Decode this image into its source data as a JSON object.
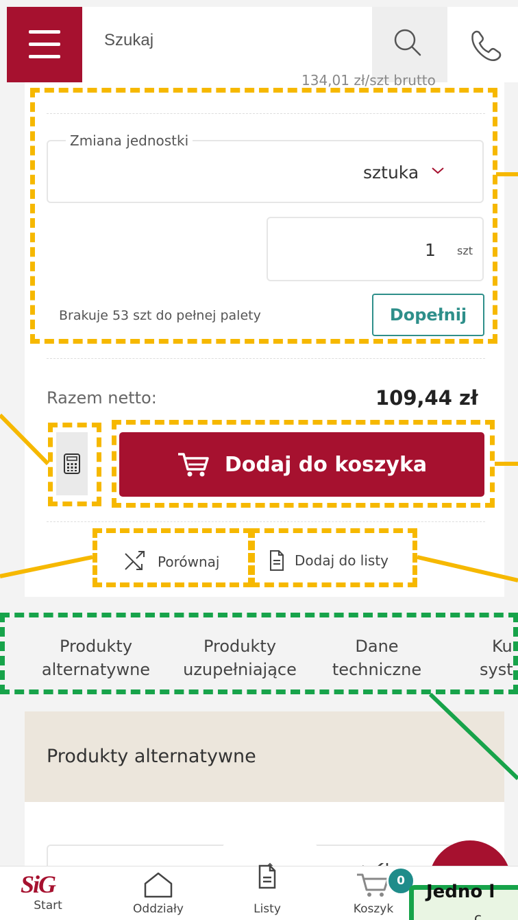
{
  "header": {
    "search_placeholder": "Szukaj"
  },
  "product": {
    "cut_price_text": "134,01 zł/szt brutto",
    "unit_change_label": "Zmiana jednostki",
    "unit_value": "sztuka",
    "quantity_value": "1",
    "quantity_unit": "szt",
    "pallet_note": "Brakuje 53 szt do pełnej palety",
    "fill_button": "Dopełnij",
    "total_label": "Razem netto:",
    "total_value": "109,44 zł",
    "add_to_cart": "Dodaj do koszyka",
    "compare": "Porównaj",
    "add_to_list": "Dodaj do listy"
  },
  "tabs": [
    {
      "line1": "Produkty",
      "line2": "alternatywne"
    },
    {
      "line1": "Produkty",
      "line2": "uzupełniające"
    },
    {
      "line1": "Dane",
      "line2": "techniczne"
    },
    {
      "line1": "Ku",
      "line2": "syst"
    }
  ],
  "section": {
    "title": "Produkty alternatywne"
  },
  "bottom_nav": {
    "logo": "SiG",
    "start": "Start",
    "branches": "Oddziały",
    "lists": "Listy",
    "cart": "Koszyk",
    "cart_count": "0"
  },
  "annotation": {
    "callout_text": "Jedno l",
    "callout_text2": "c"
  },
  "colors": {
    "brand": "#a6112f",
    "teal": "#2e8f8a",
    "annotation_yellow": "#f6b800",
    "annotation_green": "#17a34a"
  }
}
